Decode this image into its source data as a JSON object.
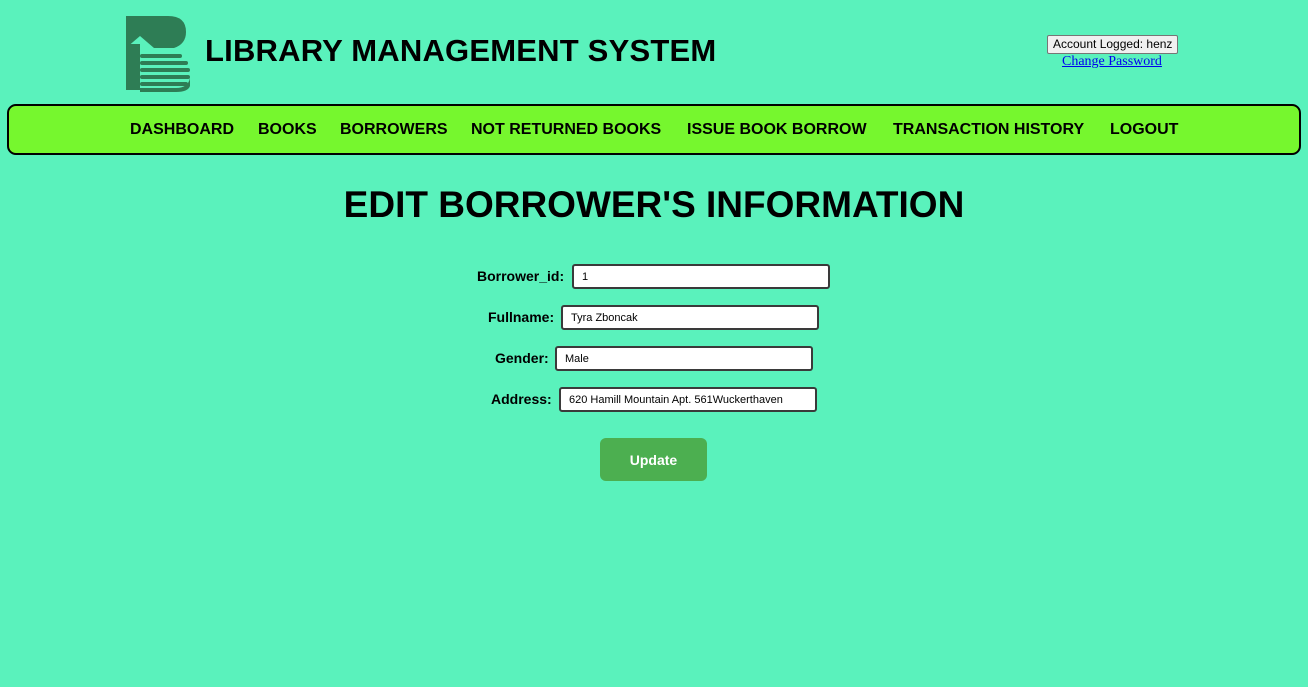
{
  "header": {
    "site_title": "LIBRARY MANAGEMENT SYSTEM",
    "account_label": "Account Logged: henz",
    "change_password_label": "Change Password"
  },
  "nav": {
    "items": [
      {
        "label": "DASHBOARD"
      },
      {
        "label": "BOOKS"
      },
      {
        "label": "BORROWERS"
      },
      {
        "label": "NOT RETURNED BOOKS"
      },
      {
        "label": "ISSUE BOOK BORROW"
      },
      {
        "label": "TRANSACTION HISTORY"
      },
      {
        "label": "LOGOUT"
      }
    ]
  },
  "page": {
    "heading": "EDIT BORROWER'S INFORMATION"
  },
  "form": {
    "borrower_id_label": "Borrower_id:",
    "borrower_id_value": "1",
    "fullname_label": "Fullname:",
    "fullname_value": "Tyra Zboncak",
    "gender_label": "Gender:",
    "gender_value": "Male",
    "address_label": "Address:",
    "address_value": "620 Hamill Mountain Apt. 561Wuckerthaven",
    "update_label": "Update"
  },
  "colors": {
    "background": "#5af2bc",
    "navbar": "#76f72e",
    "logo": "#2e7d55",
    "button": "#4caf50"
  },
  "icons": {
    "logo": "book-b-logo-icon"
  }
}
